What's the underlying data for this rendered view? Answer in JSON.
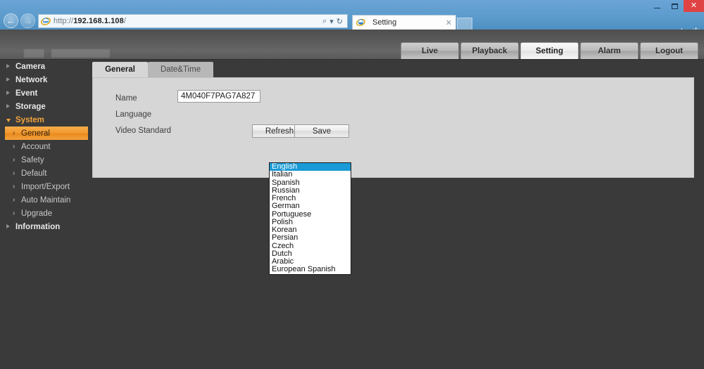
{
  "browser": {
    "window_controls": {
      "minimize": "minimize-icon",
      "maximize": "restore-icon",
      "close": "✕"
    },
    "back_icon": "←",
    "forward_icon": "→",
    "address": {
      "protocol": "http://",
      "host": "192.168.1.108",
      "path": "/",
      "full": "http://192.168.1.108/"
    },
    "address_tools": {
      "search_icon": "⌕",
      "dropdown_icon": "▾",
      "refresh_icon": "↻"
    },
    "tab": {
      "title": "Setting",
      "close": "✕",
      "favicon": "ie-logo-icon"
    },
    "toolbar_icons": [
      {
        "name": "home-icon",
        "glyph": "⌂"
      },
      {
        "name": "favorites-star-icon",
        "glyph": "★"
      },
      {
        "name": "tools-gear-icon",
        "glyph": "✲"
      }
    ]
  },
  "topnav": {
    "items": [
      {
        "label": "Live",
        "active": false
      },
      {
        "label": "Playback",
        "active": false
      },
      {
        "label": "Setting",
        "active": true
      },
      {
        "label": "Alarm",
        "active": false
      },
      {
        "label": "Logout",
        "active": false
      }
    ]
  },
  "sidebar": {
    "items": [
      {
        "label": "Camera",
        "level": 1,
        "open": false,
        "selected": false
      },
      {
        "label": "Network",
        "level": 1,
        "open": false,
        "selected": false
      },
      {
        "label": "Event",
        "level": 1,
        "open": false,
        "selected": false
      },
      {
        "label": "Storage",
        "level": 1,
        "open": false,
        "selected": false
      },
      {
        "label": "System",
        "level": 1,
        "open": true,
        "selected": false
      },
      {
        "label": "General",
        "level": 2,
        "open": false,
        "selected": true
      },
      {
        "label": "Account",
        "level": 2,
        "open": false,
        "selected": false
      },
      {
        "label": "Safety",
        "level": 2,
        "open": false,
        "selected": false
      },
      {
        "label": "Default",
        "level": 2,
        "open": false,
        "selected": false
      },
      {
        "label": "Import/Export",
        "level": 2,
        "open": false,
        "selected": false
      },
      {
        "label": "Auto Maintain",
        "level": 2,
        "open": false,
        "selected": false
      },
      {
        "label": "Upgrade",
        "level": 2,
        "open": false,
        "selected": false
      },
      {
        "label": "Information",
        "level": 1,
        "open": false,
        "selected": false
      }
    ]
  },
  "content": {
    "tabs": [
      {
        "label": "General",
        "active": true
      },
      {
        "label": "Date&Time",
        "active": false
      }
    ],
    "fields": {
      "name_label": "Name",
      "name_value": "4M040F7PAG7A827",
      "language_label": "Language",
      "video_standard_label": "Video Standard"
    },
    "buttons": {
      "refresh": "Refresh",
      "save": "Save"
    },
    "language_select": {
      "selected": "English",
      "options": [
        "English",
        "Italian",
        "Spanish",
        "Russian",
        "French",
        "German",
        "Portuguese",
        "Polish",
        "Korean",
        "Persian",
        "Czech",
        "Dutch",
        "Arabic",
        "European Spanish"
      ]
    }
  },
  "colors": {
    "accent_orange": "#f2982e",
    "select_highlight": "#1a9ad6",
    "panel_gray": "#d6d6d6",
    "app_dark": "#3a3a3a",
    "browser_blue": "#5b9bd0",
    "close_red": "#e04343"
  }
}
